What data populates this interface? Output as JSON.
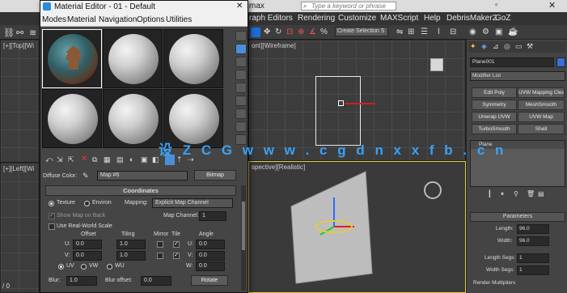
{
  "main": {
    "title_fragment": "max",
    "search_placeholder": "Type a keyword or phrase",
    "menu": [
      "raph Editors",
      "Rendering",
      "Customize",
      "MAXScript",
      "Help",
      "DebrisMaker2",
      "GoZ"
    ],
    "selection_set": "Create Selection S"
  },
  "viewports": {
    "top_label": "[+][Top][Wi",
    "left_label": "[+][Left][Wi",
    "front_label": "ont][Wireframe]",
    "persp_label": "spective][Realistic]"
  },
  "command_panel": {
    "object_name": "Plane001",
    "modifier_list": "Modifier List",
    "buttons": [
      "Edit Poly",
      "UVW Mapping Clear",
      "Symmetry",
      "MeshSmooth",
      "Unwrap UVW",
      "UVW Map",
      "TurboSmooth",
      "Shell"
    ],
    "stack_item": "Plane",
    "rollout_title": "Parameters",
    "params": [
      {
        "label": "Length:",
        "value": "96.0"
      },
      {
        "label": "Width:",
        "value": "96.0"
      },
      {
        "label": "Length Segs:",
        "value": "1"
      },
      {
        "label": "Width Segs:",
        "value": "1"
      }
    ],
    "render_multipliers": "Render Multipliers",
    "accent": "#3a6fd8"
  },
  "material_editor": {
    "title": "Material Editor - 01 - Default",
    "menu": [
      "Modes",
      "Material",
      "Navigation",
      "Options",
      "Utilities"
    ],
    "diffuse_label": "Diffuse Color:",
    "map_name": "Map #6",
    "map_type": "Bitmap",
    "rollout_title": "Coordinates",
    "texture_label": "Texture",
    "environ_label": "Environ",
    "mapping_label": "Mapping:",
    "mapping_value": "Explicit Map Channel",
    "show_map_label": "Show Map on Back",
    "map_channel_label": "Map Channel:",
    "map_channel_value": "1",
    "real_world_label": "Use Real-World Scale",
    "col_offset": "Offset",
    "col_tiling": "Tiling",
    "col_mirror": "Mirror",
    "col_tile": "Tile",
    "col_angle": "Angle",
    "u_label": "U:",
    "v_label": "V:",
    "w_label": "W:",
    "u_offset": "0.0",
    "v_offset": "0.0",
    "u_tiling": "1.0",
    "v_tiling": "1.0",
    "u_angle": "0.0",
    "v_angle": "0.0",
    "w_angle": "0.0",
    "uv": "UV",
    "vw": "VW",
    "wu": "WU",
    "blur_label": "Blur:",
    "blur_value": "1.0",
    "blur_offset_label": "Blur offset:",
    "blur_offset_value": "0.0",
    "rotate_label": "Rotate",
    "bottom_fragment": "/ 0 "
  },
  "watermark": "设 Z C G  w w w . c g d n x x f b . c n"
}
